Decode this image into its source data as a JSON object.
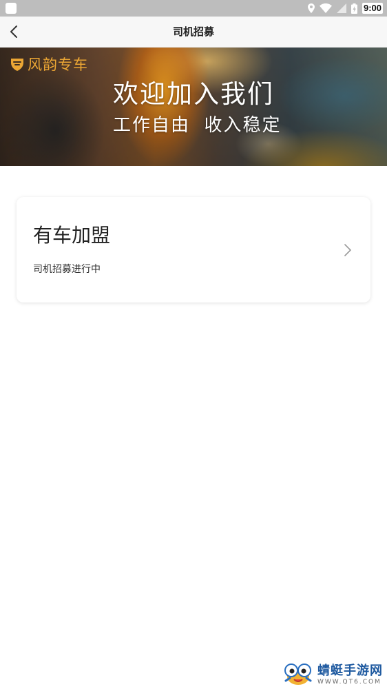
{
  "status_bar": {
    "time": "9:00",
    "icons": [
      "app-icon",
      "location-icon",
      "wifi-icon",
      "signal-icon",
      "battery-icon"
    ]
  },
  "nav": {
    "title": "司机招募",
    "back_icon": "chevron-left-icon"
  },
  "banner": {
    "brand": "风韵专车",
    "brand_icon": "shield-logo-icon",
    "headline": "欢迎加入我们",
    "subline": "工作自由  收入稳定",
    "brand_color": "#e8a63a"
  },
  "card": {
    "title": "有车加盟",
    "subtitle": "司机招募进行中",
    "chevron_icon": "chevron-right-icon"
  },
  "watermark": {
    "name": "蜻蜓手游网",
    "url": "WWW.QT6.COM",
    "logo_icon": "cartoon-mascot-logo"
  }
}
